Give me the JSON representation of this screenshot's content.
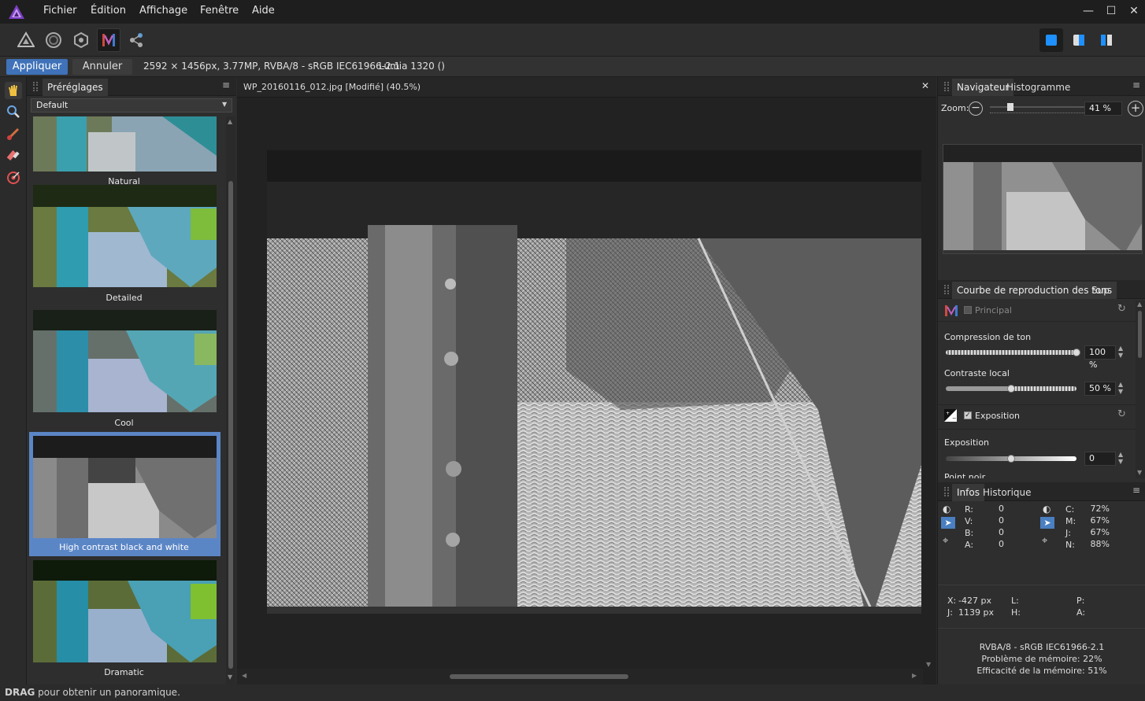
{
  "menu": {
    "items": [
      "Fichier",
      "Édition",
      "Affichage",
      "Fenêtre",
      "Aide"
    ]
  },
  "window": {
    "minimize": "—",
    "maximize": "☐",
    "close": "✕"
  },
  "toolbar": {
    "personas": [
      "photo-persona-icon",
      "liquify-persona-icon",
      "develop-persona-icon",
      "tone-mapping-persona-icon",
      "export-persona-icon"
    ],
    "active": "tone-mapping-persona-icon"
  },
  "context": {
    "apply_label": "Appliquer",
    "cancel_label": "Annuler",
    "image_info": "2592 × 1456px, 3.77MP, RVBA/8 - sRGB IEC61966-2.1",
    "camera": "Lumia 1320 ()"
  },
  "tools": [
    "hand-tool-icon",
    "zoom-tool-icon",
    "brush-tool-icon",
    "eraser-tool-icon",
    "target-tool-icon"
  ],
  "presets": {
    "tab": "Préréglages",
    "category": "Default",
    "items": [
      {
        "label": "Natural"
      },
      {
        "label": "Detailed"
      },
      {
        "label": "Cool"
      },
      {
        "label": "High contrast black and white",
        "selected": true
      },
      {
        "label": "Dramatic"
      }
    ]
  },
  "document": {
    "tab_title": "WP_20160116_012.jpg [Modifié] (40.5%)"
  },
  "navigator": {
    "tabs": [
      "Navigateur",
      "Histogramme"
    ],
    "zoom_label": "Zoom:",
    "zoom_value": "41 %",
    "zoom_fraction": 0.41
  },
  "tone_panel": {
    "tabs": [
      "Courbe de reproduction des tons",
      "Sup"
    ],
    "principal_label": "Principal",
    "compression_label": "Compression de ton",
    "compression_value": "100 %",
    "compression_fraction": 1.0,
    "contrast_label": "Contraste local",
    "contrast_value": "50 %",
    "contrast_fraction": 0.5,
    "exposure_group_label": "Exposition",
    "exposure_label": "Exposition",
    "exposure_value": "0",
    "exposure_fraction": 0.5,
    "blackpoint_label": "Point noir"
  },
  "info_panel": {
    "tabs": [
      "Infos",
      "Historique"
    ],
    "rgb": [
      {
        "k": "R:",
        "v": "0"
      },
      {
        "k": "V:",
        "v": "0"
      },
      {
        "k": "B:",
        "v": "0"
      },
      {
        "k": "A:",
        "v": "0"
      }
    ],
    "cmyk": [
      {
        "k": "C:",
        "v": "72%"
      },
      {
        "k": "M:",
        "v": "67%"
      },
      {
        "k": "J:",
        "v": "67%"
      },
      {
        "k": "N:",
        "v": "88%"
      }
    ],
    "x_label": "X:",
    "x_value": "-427 px",
    "y_label": "J:",
    "y_value": "1139 px",
    "l_label": "L:",
    "h_label": "H:",
    "p_label": "P:",
    "a_label": "A:",
    "summary": [
      "RVBA/8 - sRGB IEC61966-2.1",
      "Problème de mémoire: 22%",
      "Efficacité de la mémoire: 51%"
    ]
  },
  "status": {
    "bold": "DRAG",
    "text": " pour obtenir un panoramique."
  },
  "colors": {
    "accent": "#4a7fc1",
    "selection": "#5b86c6",
    "tab_active": "#383838"
  }
}
